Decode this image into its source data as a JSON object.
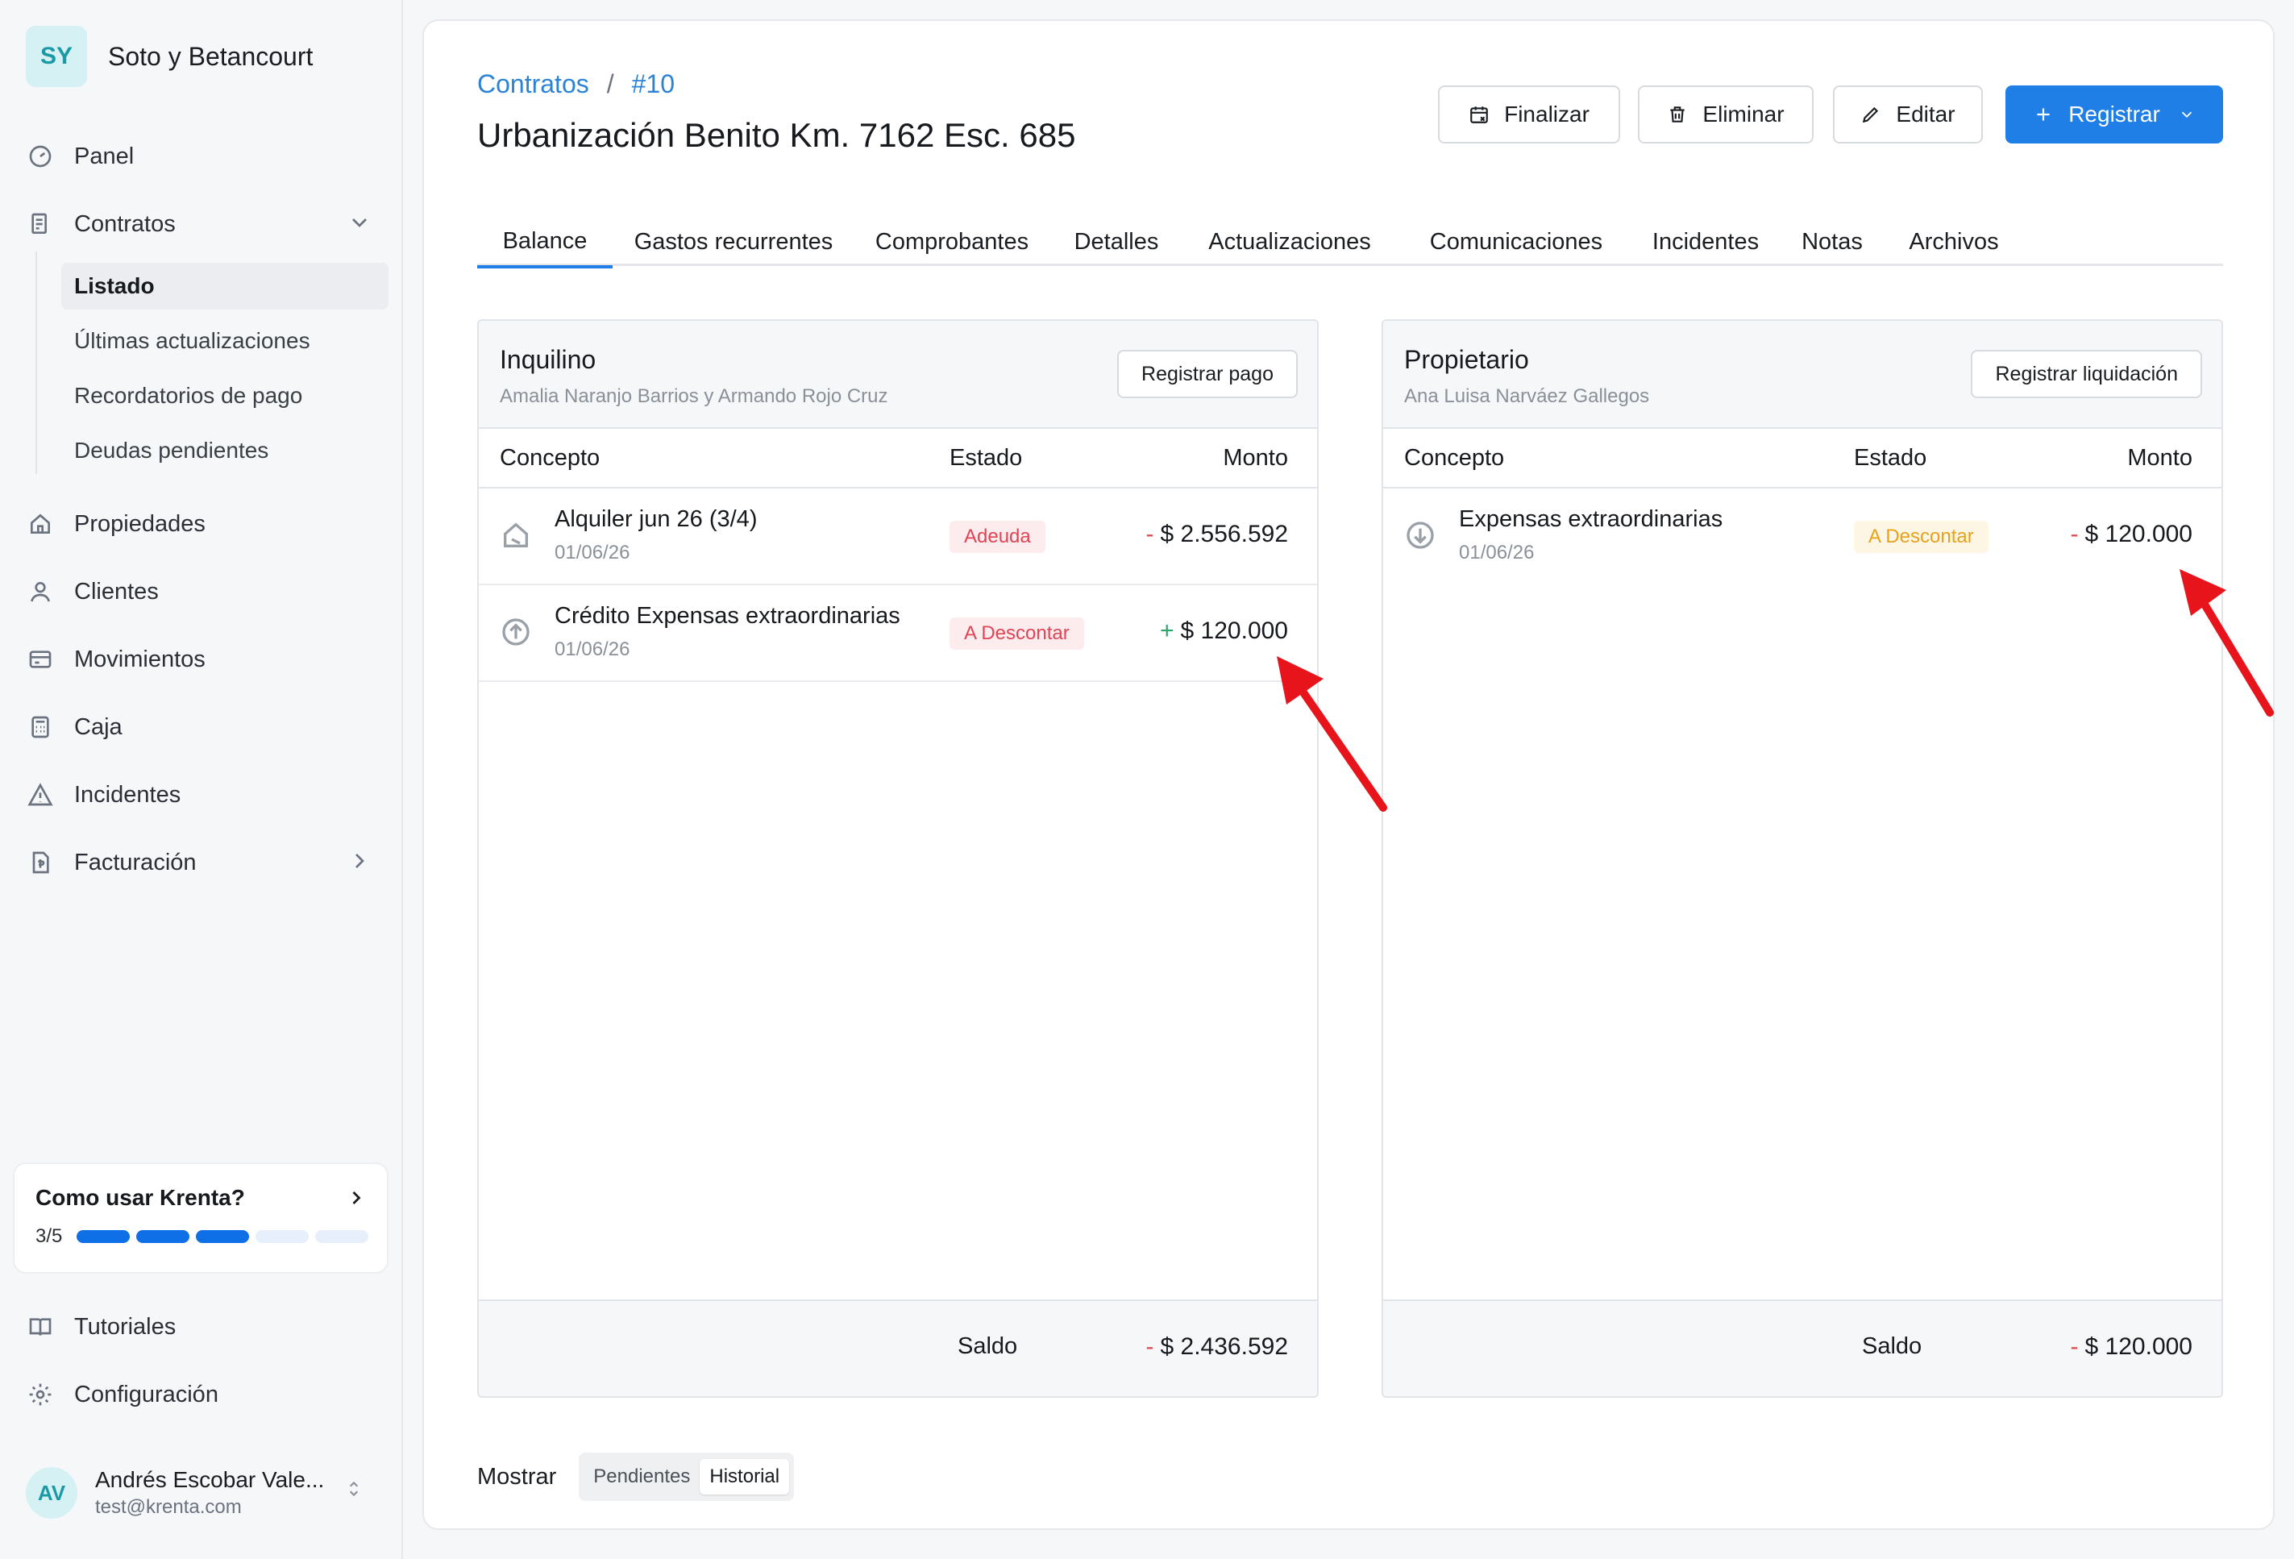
{
  "sidebar": {
    "org_initials": "SY",
    "org_name": "Soto y Betancourt",
    "nav": {
      "panel": "Panel",
      "contratos": "Contratos",
      "propiedades": "Propiedades",
      "clientes": "Clientes",
      "movimientos": "Movimientos",
      "caja": "Caja",
      "incidentes": "Incidentes",
      "facturacion": "Facturación",
      "tutoriales": "Tutoriales",
      "configuracion": "Configuración"
    },
    "contratos_sub": [
      "Listado",
      "Últimas actualizaciones",
      "Recordatorios de pago",
      "Deudas pendientes"
    ],
    "help": {
      "title": "Como usar Krenta?",
      "progress_label": "3/5",
      "done": 3,
      "total": 5
    },
    "user": {
      "initials": "AV",
      "name": "Andrés Escobar Vale...",
      "email": "test@krenta.com"
    }
  },
  "header": {
    "breadcrumb_root": "Contratos",
    "breadcrumb_sep": "/",
    "breadcrumb_id": "#10",
    "title": "Urbanización Benito Km. 7162 Esc. 685",
    "buttons": {
      "finalizar": "Finalizar",
      "eliminar": "Eliminar",
      "editar": "Editar",
      "registrar": "Registrar"
    }
  },
  "tabs": [
    "Balance",
    "Gastos recurrentes",
    "Comprobantes",
    "Detalles",
    "Actualizaciones",
    "Comunicaciones",
    "Incidentes",
    "Notas",
    "Archivos"
  ],
  "columns": {
    "concepto": "Concepto",
    "estado": "Estado",
    "monto": "Monto"
  },
  "inquilino": {
    "title": "Inquilino",
    "subtitle": "Amalia Naranjo Barrios y Armando Rojo Cruz",
    "action": "Registrar pago",
    "rows": [
      {
        "icon": "house-icon",
        "concept": "Alquiler jun 26 (3/4)",
        "date": "01/06/26",
        "status": "Adeuda",
        "sign": "-",
        "amount": "$ 2.556.592"
      },
      {
        "icon": "arrow-up-circle-icon",
        "concept": "Crédito Expensas extraordinarias",
        "date": "01/06/26",
        "status": "A Descontar",
        "sign": "+",
        "amount": "$ 120.000"
      }
    ],
    "saldo_label": "Saldo",
    "saldo_sign": "-",
    "saldo": "$ 2.436.592"
  },
  "propietario": {
    "title": "Propietario",
    "subtitle": "Ana Luisa Narváez Gallegos",
    "action": "Registrar liquidación",
    "rows": [
      {
        "icon": "arrow-down-circle-icon",
        "concept": "Expensas extraordinarias",
        "date": "01/06/26",
        "status": "A Descontar",
        "sign": "-",
        "amount": "$ 120.000"
      }
    ],
    "saldo_label": "Saldo",
    "saldo_sign": "-",
    "saldo": "$ 120.000"
  },
  "show": {
    "label": "Mostrar",
    "options": [
      "Pendientes",
      "Historial"
    ],
    "selected": "Historial"
  },
  "colors": {
    "accent": "#1f7fe6",
    "danger": "#e04455",
    "warning": "#e7a21b",
    "success": "#2aa56b",
    "annotation": "#e8141b"
  }
}
